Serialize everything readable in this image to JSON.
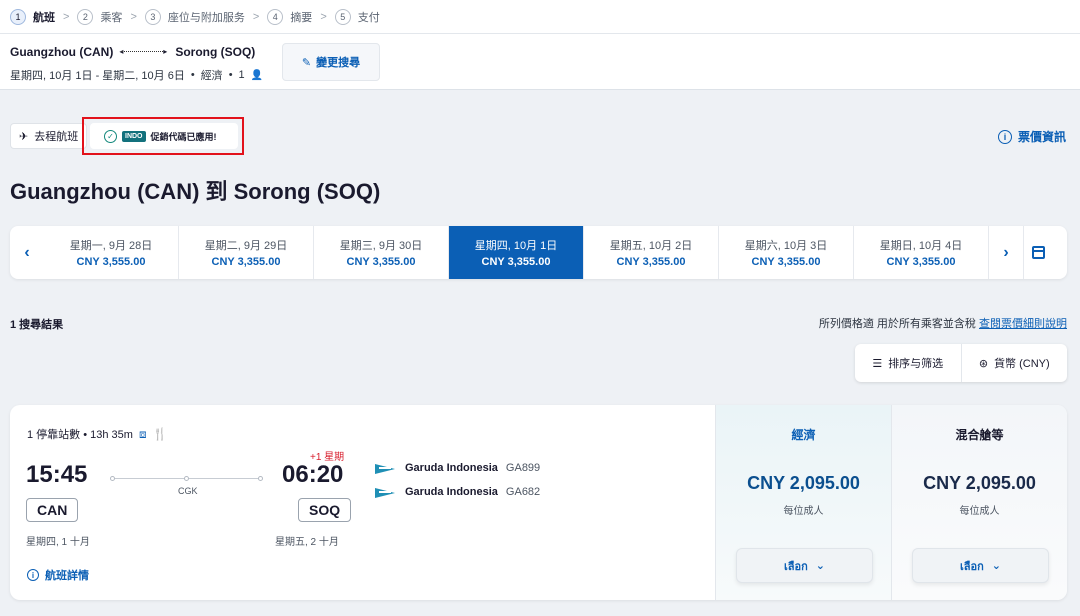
{
  "stepper": {
    "steps": [
      {
        "num": "1",
        "label": "航班"
      },
      {
        "num": "2",
        "label": "乘客"
      },
      {
        "num": "3",
        "label": "座位与附加服务"
      },
      {
        "num": "4",
        "label": "摘要"
      },
      {
        "num": "5",
        "label": "支付"
      }
    ],
    "separator": ">"
  },
  "trip": {
    "origin": "Guangzhou (CAN)",
    "destination": "Sorong (SOQ)",
    "dates": "星期四, 10月 1日 - 星期二, 10月 6日",
    "cabin": "經濟",
    "passengers": "1",
    "bullet": "•",
    "modify_label": "變更搜尋"
  },
  "tabs": {
    "outbound_label": "去程航班",
    "promo_code": "INDO",
    "promo_text": "促銷代碼已應用!",
    "fare_info_label": "票價資訊"
  },
  "page_title": "Guangzhou (CAN) 到 Sorong (SOQ)",
  "date_carousel": {
    "prev": "‹",
    "next": "›",
    "dates": [
      {
        "day": "星期一, 9月 28日",
        "price": "CNY 3,555.00"
      },
      {
        "day": "星期二, 9月 29日",
        "price": "CNY 3,355.00"
      },
      {
        "day": "星期三, 9月 30日",
        "price": "CNY 3,355.00"
      },
      {
        "day": "星期四, 10月 1日",
        "price": "CNY 3,355.00"
      },
      {
        "day": "星期五, 10月 2日",
        "price": "CNY 3,355.00"
      },
      {
        "day": "星期六, 10月 3日",
        "price": "CNY 3,355.00"
      },
      {
        "day": "星期日, 10月 4日",
        "price": "CNY 3,355.00"
      }
    ]
  },
  "results": {
    "count_label": "1 搜尋結果",
    "price_note": "所列價格適 用於所有乘客並含稅",
    "price_note_link": "查閱票價細則說明",
    "sort_label": "排序与筛选",
    "currency_label": "貨幣 (CNY)"
  },
  "flight": {
    "stops": "1 停靠站數 • 13h 35m",
    "dep_time": "15:45",
    "arr_time": "06:20",
    "plus_day": "+1 星期",
    "via": "CGK",
    "dep_airport": "CAN",
    "arr_airport": "SOQ",
    "dep_date": "星期四, 1 十月",
    "arr_date": "星期五, 2 十月",
    "details_label": "航班詳情",
    "segments": [
      {
        "airline": "Garuda Indonesia",
        "flight_no": "GA899"
      },
      {
        "airline": "Garuda Indonesia",
        "flight_no": "GA682"
      }
    ]
  },
  "fares": [
    {
      "title": "經濟",
      "price": "CNY 2,095.00",
      "per": "每位成人",
      "select": "เลือก"
    },
    {
      "title": "混合艙等",
      "price": "CNY 2,095.00",
      "per": "每位成人",
      "select": "เลือก"
    }
  ],
  "colors": {
    "brand_blue": "#0b5fb5",
    "teal": "#13717d",
    "highlight_red": "#e2121b",
    "plus_day_red": "#d81e2c"
  }
}
